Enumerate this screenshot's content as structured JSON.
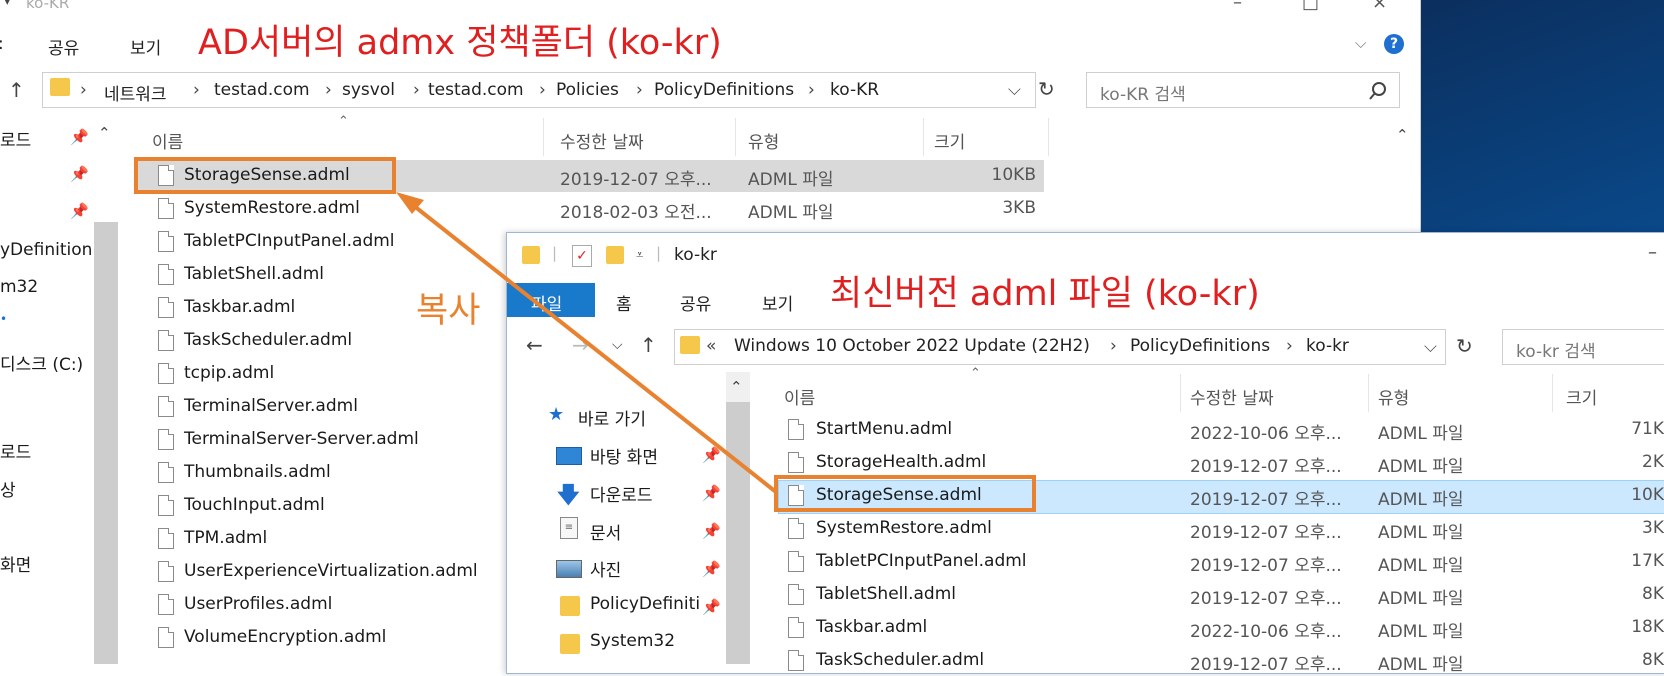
{
  "window1": {
    "title": "ko-KR",
    "ribbon_tabs": [
      "공유",
      "보기"
    ],
    "address": [
      "네트워크",
      "testad.com",
      "sysvol",
      "testad.com",
      "Policies",
      "PolicyDefinitions",
      "ko-KR"
    ],
    "search_placeholder": "ko-KR 검색",
    "columns": [
      "이름",
      "수정한 날짜",
      "유형",
      "크기"
    ],
    "nav_items": [
      "로드",
      "yDefinition",
      "m32",
      "디스크 (C:)",
      "로드",
      "상",
      "화면"
    ],
    "files": [
      {
        "name": "StorageSense.adml",
        "date": "2019-12-07 오후...",
        "type": "ADML 파일",
        "size": "10KB"
      },
      {
        "name": "SystemRestore.adml",
        "date": "2018-02-03 오전...",
        "type": "ADML 파일",
        "size": "3KB"
      },
      {
        "name": "TabletPCInputPanel.adml"
      },
      {
        "name": "TabletShell.adml"
      },
      {
        "name": "Taskbar.adml"
      },
      {
        "name": "TaskScheduler.adml"
      },
      {
        "name": "tcpip.adml"
      },
      {
        "name": "TerminalServer.adml"
      },
      {
        "name": "TerminalServer-Server.adml"
      },
      {
        "name": "Thumbnails.adml"
      },
      {
        "name": "TouchInput.adml"
      },
      {
        "name": "TPM.adml"
      },
      {
        "name": "UserExperienceVirtualization.adml"
      },
      {
        "name": "UserProfiles.adml"
      },
      {
        "name": "VolumeEncryption.adml"
      }
    ]
  },
  "window2": {
    "title": "ko-kr",
    "ribbon_tabs": [
      "파일",
      "홈",
      "공유",
      "보기"
    ],
    "address": [
      "Windows 10 October 2022 Update (22H2)",
      "PolicyDefinitions",
      "ko-kr"
    ],
    "search_placeholder": "ko-kr 검색",
    "columns": [
      "이름",
      "수정한 날짜",
      "유형",
      "크기"
    ],
    "quick_access": "바로 가기",
    "nav_items": [
      "바탕 화면",
      "다운로드",
      "문서",
      "사진",
      "PolicyDefiniti",
      "System32"
    ],
    "files": [
      {
        "name": "StartMenu.adml",
        "date": "2022-10-06 오후...",
        "type": "ADML 파일",
        "size": "71K"
      },
      {
        "name": "StorageHealth.adml",
        "date": "2019-12-07 오후...",
        "type": "ADML 파일",
        "size": "2K"
      },
      {
        "name": "StorageSense.adml",
        "date": "2019-12-07 오후...",
        "type": "ADML 파일",
        "size": "10K"
      },
      {
        "name": "SystemRestore.adml",
        "date": "2019-12-07 오후...",
        "type": "ADML 파일",
        "size": "3K"
      },
      {
        "name": "TabletPCInputPanel.adml",
        "date": "2019-12-07 오후...",
        "type": "ADML 파일",
        "size": "17K"
      },
      {
        "name": "TabletShell.adml",
        "date": "2019-12-07 오후...",
        "type": "ADML 파일",
        "size": "8K"
      },
      {
        "name": "Taskbar.adml",
        "date": "2022-10-06 오후...",
        "type": "ADML 파일",
        "size": "18K"
      },
      {
        "name": "TaskScheduler.adml",
        "date": "2019-12-07 오후...",
        "type": "ADML 파일",
        "size": "8K"
      }
    ]
  },
  "annotations": {
    "top": "AD서버의 admx 정책폴더 (ko-kr)",
    "bottom": "최신버전 adml 파일 (ko-kr)",
    "copy": "복사"
  },
  "colors": {
    "highlight": "#e8822f",
    "annotation_text": "#e02020",
    "file_tab": "#1979ca"
  }
}
